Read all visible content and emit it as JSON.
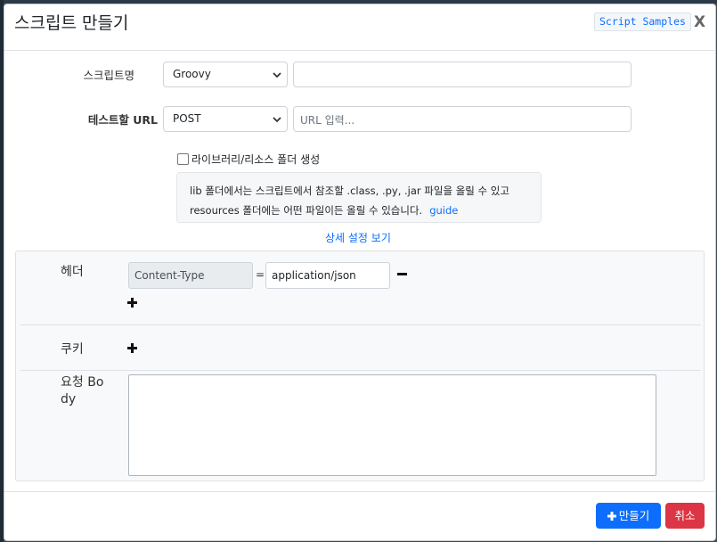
{
  "modal": {
    "title": "스크립트 만들기",
    "samples_label": "Script Samples",
    "close_label": "X"
  },
  "form": {
    "script_name_label": "스크립트명",
    "language_value": "Groovy",
    "script_name_value": "",
    "test_url_label": "테스트할 URL",
    "method_value": "POST",
    "url_placeholder": "URL 입력...",
    "lib_checkbox_label": "라이브러리/리소스 폴더 생성",
    "lib_checked": false,
    "info_line1": "lib 폴더에서는 스크립트에서 참조할 .class, .py, .jar 파일을 올릴 수 있고",
    "info_line2": "resources 폴더에는 어떤 파일이든 올릴 수 있습니다.",
    "guide_link": "guide",
    "advanced_link": "상세 설정 보기"
  },
  "advanced": {
    "headers_label": "헤더",
    "headers": [
      {
        "key": "Content-Type",
        "value": "application/json"
      }
    ],
    "eq_sign": "=",
    "cookies_label": "쿠키",
    "body_label_line1": "요청 Bo",
    "body_label_line2": "dy",
    "body_value": ""
  },
  "footer": {
    "create_label": "만들기",
    "cancel_label": "취소"
  },
  "colors": {
    "primary": "#0d6efd",
    "danger": "#dc3545"
  }
}
